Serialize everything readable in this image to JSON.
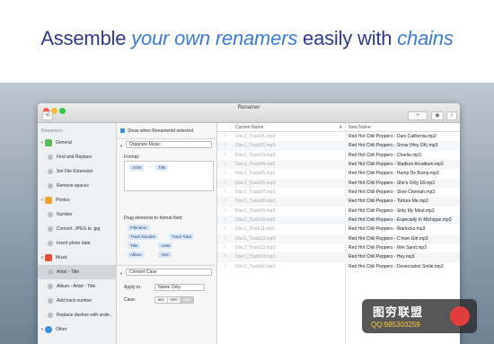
{
  "banner": {
    "pre": "Assemble ",
    "emphasis1": "your own renamers",
    "mid": " easily with ",
    "emphasis2": "chains"
  },
  "window": {
    "title": "Renamer",
    "toolbar": {
      "add": "+",
      "eye": "◉",
      "info": "i",
      "link": "⟲"
    }
  },
  "sidebar": {
    "heading": "Renamers",
    "groups": [
      {
        "label": "General",
        "icon": "gear-icon",
        "items": [
          "Find and Replace",
          "Set File Extension",
          "Remove spaces"
        ]
      },
      {
        "label": "Photos",
        "icon": "photo-icon",
        "items": [
          "Number",
          "Convert .JPEG to .jpg",
          "Insert photo date"
        ]
      },
      {
        "label": "Music",
        "icon": "music-note-icon",
        "items": [
          "Artist - Title",
          "Album - Artist - Title",
          "Add track number",
          "Replace dashes with unde..."
        ]
      },
      {
        "label": "Other",
        "icon": "globe-icon",
        "items": []
      }
    ],
    "selected": "Artist - Title"
  },
  "config": {
    "show_checkbox": "Show when Renamerlet selected",
    "section1": "Organize Music",
    "format_label": "Format:",
    "format_tokens": [
      "Artist",
      "-",
      "Title"
    ],
    "drag_label": "Drag elements to format field:",
    "elements": [
      "Filename",
      "Track Number",
      "Track Total",
      "Title",
      "Artist",
      "Album",
      "Year"
    ],
    "section2": "Convert Case",
    "apply_label": "Apply to:",
    "apply_value": "Name Only",
    "case_label": "Case:",
    "case_options": [
      "abc",
      "ABC",
      "Abc"
    ]
  },
  "table": {
    "col_current": "Current Name",
    "col_new": "New Name",
    "sort_arrow": "▾",
    "rows": [
      {
        "current": "Disc1_Track01.mp3",
        "new": "Red Hot Chili Peppers - Dani California.mp3"
      },
      {
        "current": "Disc1_Track02.mp3",
        "new": "Red Hot Chili Peppers - Snow (Hey Oh).mp3"
      },
      {
        "current": "Disc1_Track03.mp3",
        "new": "Red Hot Chili Peppers - Charlie.mp3"
      },
      {
        "current": "Disc1_Track04.mp3",
        "new": "Red Hot Chili Peppers - Stadium Arcadium.mp3"
      },
      {
        "current": "Disc1_Track05.mp3",
        "new": "Red Hot Chili Peppers - Hump De Bump.mp3"
      },
      {
        "current": "Disc1_Track06.mp3",
        "new": "Red Hot Chili Peppers - She's Only 18.mp3"
      },
      {
        "current": "Disc1_Track07.mp3",
        "new": "Red Hot Chili Peppers - Slow Cheetah.mp3"
      },
      {
        "current": "Disc1_Track08.mp3",
        "new": "Red Hot Chili Peppers - Torture Me.mp3"
      },
      {
        "current": "Disc1_Track09.mp3",
        "new": "Red Hot Chili Peppers - Strip My Mind.mp3"
      },
      {
        "current": "Disc1_Track10.mp3",
        "new": "Red Hot Chili Peppers - Especially In Michigan.mp3"
      },
      {
        "current": "Disc1_Track11.mp3",
        "new": "Red Hot Chili Peppers - Warlocks.mp3"
      },
      {
        "current": "Disc1_Track12.mp3",
        "new": "Red Hot Chili Peppers - C'mon Girl.mp3"
      },
      {
        "current": "Disc1_Track13.mp3",
        "new": "Red Hot Chili Peppers - Wet Sand.mp3"
      },
      {
        "current": "Disc1_Track14.mp3",
        "new": "Red Hot Chili Peppers - Hey.mp3"
      },
      {
        "current": "Disc2_Track01.mp3",
        "new": "Red Hot Chili Peppers - Desecration Smile.mp3"
      }
    ]
  },
  "watermark": {
    "line1": "图穷联盟",
    "line2": "QQ:985303259"
  },
  "colors": {
    "banner_text": "#2b3a8c",
    "banner_emphasis": "#3a7bd5",
    "selection": "#d3d6da"
  }
}
